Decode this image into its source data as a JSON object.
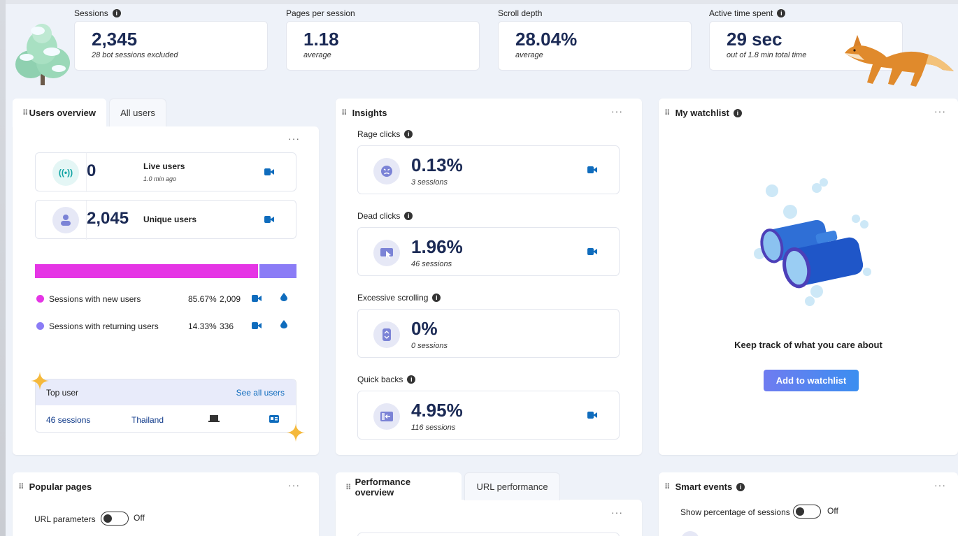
{
  "kpis": [
    {
      "label": "Sessions",
      "info": true,
      "value": "2,345",
      "sub": "28 bot sessions excluded"
    },
    {
      "label": "Pages per session",
      "info": false,
      "value": "1.18",
      "sub": "average"
    },
    {
      "label": "Scroll depth",
      "info": false,
      "value": "28.04%",
      "sub": "average"
    },
    {
      "label": "Active time spent",
      "info": true,
      "value": "29 sec",
      "sub": "out of 1.8 min total time"
    }
  ],
  "users_card": {
    "tab_active": "Users overview",
    "tab_inactive": "All users",
    "more": "···",
    "live": {
      "value": "0",
      "label": "Live users",
      "sub": "1.0 min ago"
    },
    "unique": {
      "value": "2,045",
      "label": "Unique users"
    },
    "bar": {
      "new_fraction": 0.8567,
      "new_color": "#e535e5",
      "returning_color": "#8b7cf6"
    },
    "legend": [
      {
        "label": "Sessions with new users",
        "pct": "85.67%",
        "count": "2,009",
        "color": "#e535e5"
      },
      {
        "label": "Sessions with returning users",
        "pct": "14.33%",
        "count": "336",
        "color": "#8b7cf6"
      }
    ],
    "top_user": {
      "title": "Top user",
      "link": "See all users",
      "sessions": "46 sessions",
      "country": "Thailand"
    }
  },
  "insights_card": {
    "title": "Insights",
    "more": "···",
    "items": [
      {
        "label": "Rage clicks",
        "value": "0.13%",
        "sub": "3 sessions",
        "icon": "rage-face-icon",
        "camera": true
      },
      {
        "label": "Dead clicks",
        "value": "1.96%",
        "sub": "46 sessions",
        "icon": "dead-click-icon",
        "camera": true
      },
      {
        "label": "Excessive scrolling",
        "value": "0%",
        "sub": "0 sessions",
        "icon": "scroll-icon",
        "camera": false
      },
      {
        "label": "Quick backs",
        "value": "4.95%",
        "sub": "116 sessions",
        "icon": "quick-back-icon",
        "camera": true
      }
    ]
  },
  "watchlist_card": {
    "title": "My watchlist",
    "more": "···",
    "message": "Keep track of what you care about",
    "button": "Add to watchlist"
  },
  "popular_card": {
    "title": "Popular pages",
    "more": "···",
    "toggle_label": "URL parameters",
    "toggle_state": "Off"
  },
  "performance_card": {
    "tab_active": "Performance overview",
    "tab_inactive": "URL performance",
    "more": "···"
  },
  "smart_events_card": {
    "title": "Smart events",
    "more": "···",
    "toggle_label": "Show percentage of sessions",
    "toggle_state": "Off"
  }
}
